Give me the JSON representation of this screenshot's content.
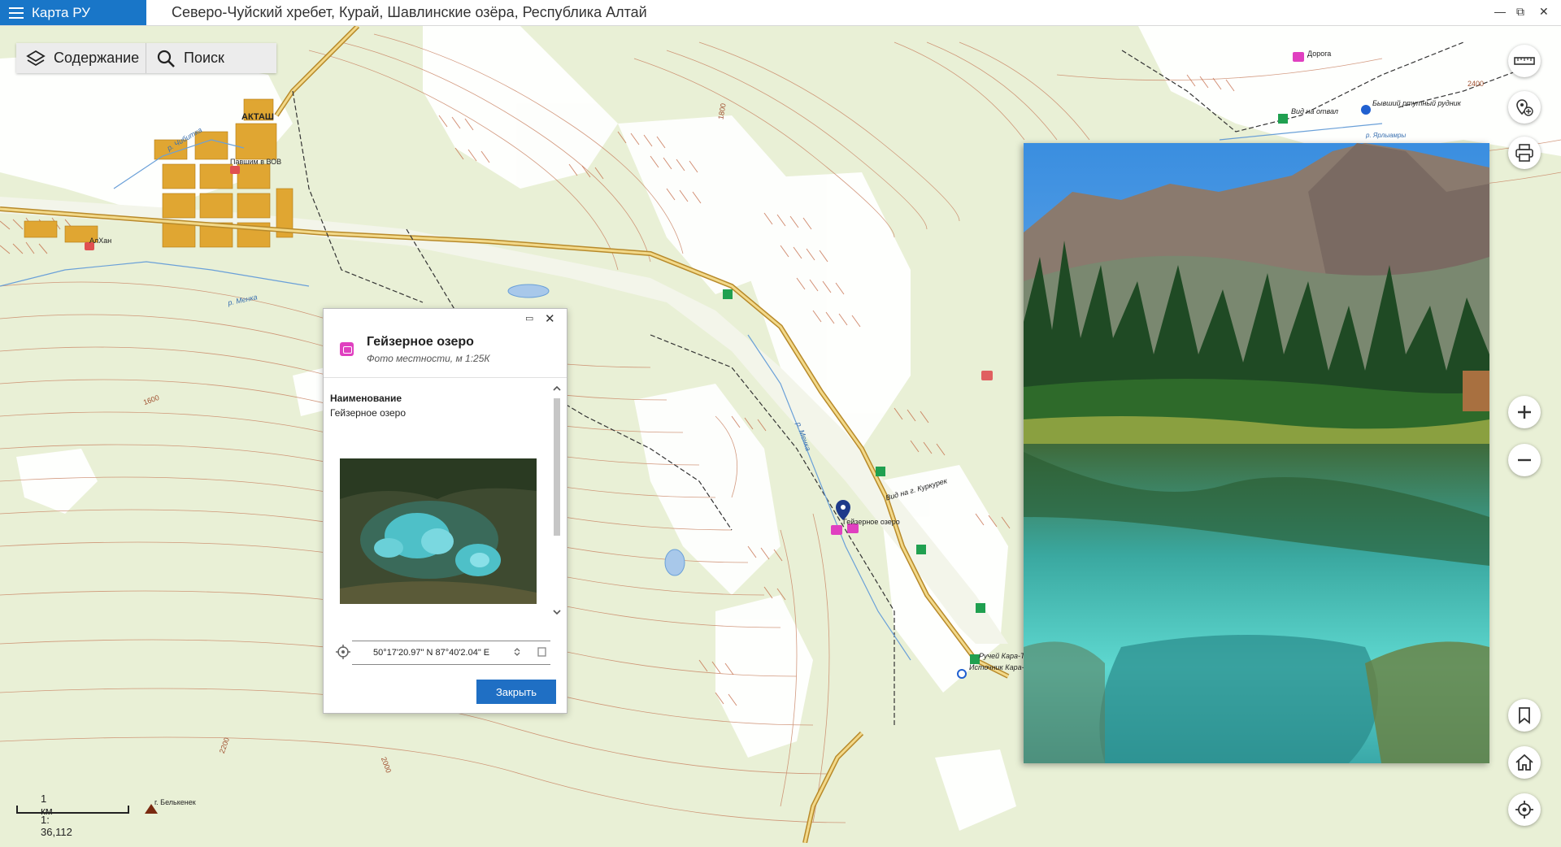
{
  "app": {
    "name": "Карта РУ",
    "title": "Северо-Чуйский хребет, Курай, Шавлинские озёра, Республика Алтай"
  },
  "window_controls": {
    "minimize": "—",
    "restore": "⧉",
    "close": "✕"
  },
  "toolbar": {
    "contents_label": "Содержание",
    "search_label": "Поиск"
  },
  "map_labels": {
    "town": "АКТАШ",
    "memorial": "Павшим в ВОВ",
    "cafe": "АлХан",
    "river_chibitka": "р. Чибитка",
    "river_menka": "р. Менка",
    "river_menka2": "р. Менка",
    "lake_label": "Гейзерное озеро",
    "view_kurkurek": "Вид на г. Куркурек",
    "stream": "Ручей Кара-Т",
    "spring": "Источник Кара-",
    "road": "Дорога",
    "view_dump": "Вид на отвал",
    "mine": "Бывший ртутный рудник",
    "river_yarlyamry": "р. Ярлыамры",
    "peak": "г. Белькенек",
    "c1800": "1800",
    "c1600": "1600",
    "c2000": "2000",
    "c2200": "2200",
    "c2400": "2400"
  },
  "popup": {
    "title": "Гейзерное озеро",
    "subtitle": "Фото местности, м 1:25К",
    "field_label": "Наименование",
    "field_value": "Гейзерное озеро",
    "coordinates": "50°17'20.97\" N 87°40'2.04\" E",
    "close_button": "Закрыть",
    "minimize": "▭",
    "close": "✕"
  },
  "scale": {
    "distance": "1 км",
    "ratio": "1: 36,112"
  },
  "colors": {
    "accent": "#1976c8",
    "map_bg": "#e9f0d6",
    "poi": "#e040c0",
    "road": "#c8a040",
    "contours": "#c88060"
  }
}
